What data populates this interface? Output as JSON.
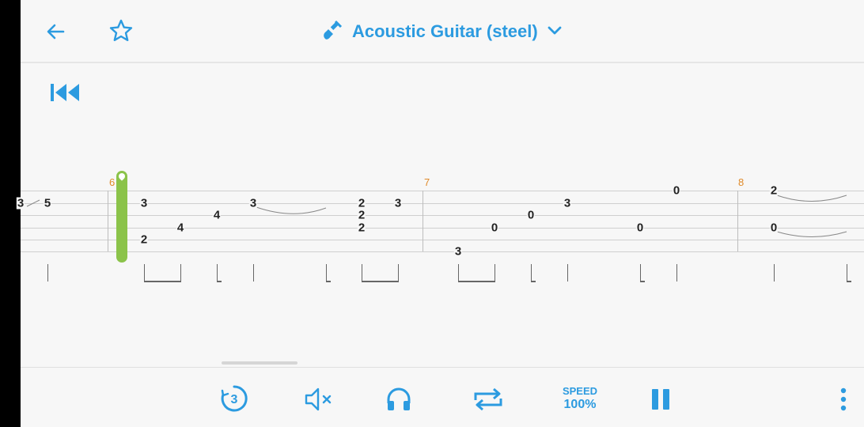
{
  "header": {
    "instrument_title": "Acoustic Guitar (steel)",
    "icons": [
      "back-arrow-icon",
      "star-icon",
      "guitar-icon",
      "chevron-down-icon"
    ]
  },
  "tab": {
    "measures": [
      {
        "number": "6"
      },
      {
        "number": "7"
      },
      {
        "number": "8"
      }
    ],
    "notes": [
      "3",
      "5",
      "3",
      "2",
      "4",
      "4",
      "3",
      "2",
      "2",
      "2",
      "3",
      "3",
      "0",
      "0",
      "3",
      "0",
      "0",
      "2",
      "0"
    ]
  },
  "toolbar": {
    "count_in": "3",
    "speed_label": "SPEED",
    "speed_value": "100%"
  },
  "colors": {
    "accent": "#2c9be0",
    "cursor": "#8bc34a",
    "measure_number": "#e08a2a"
  }
}
